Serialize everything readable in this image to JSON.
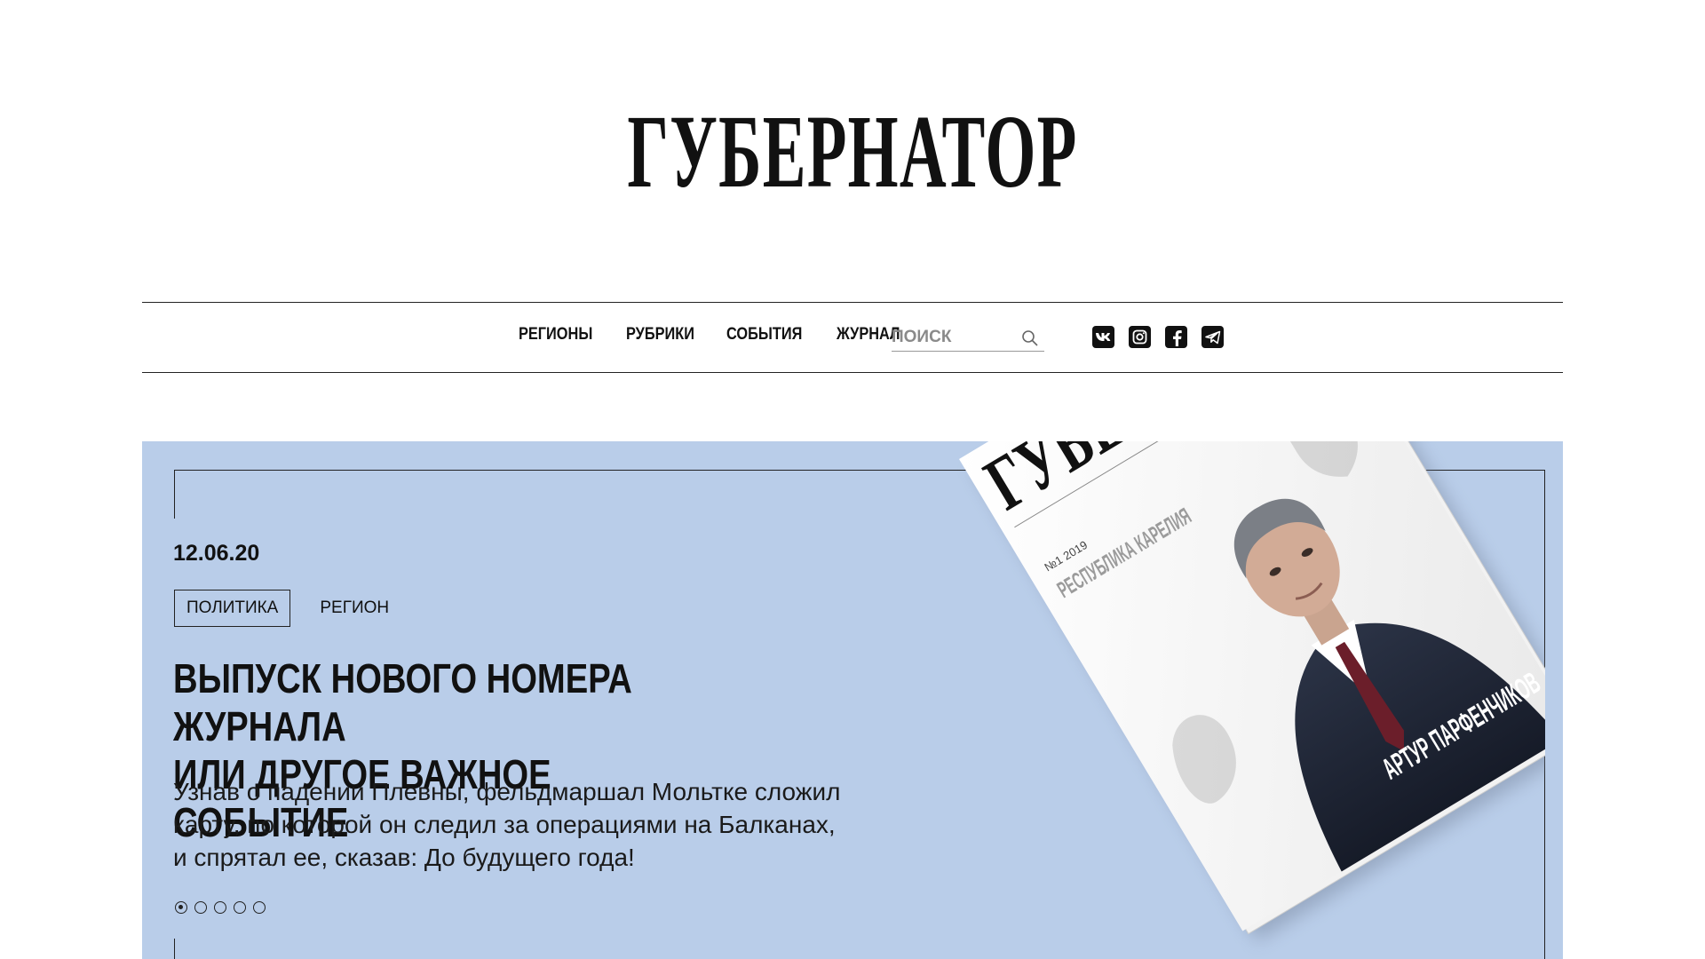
{
  "header": {
    "logo": "ГУБЕРНАТОР"
  },
  "nav": {
    "items": [
      "РЕГИОНЫ",
      "РУБРИКИ",
      "СОБЫТИЯ",
      "ЖУРНАЛ"
    ]
  },
  "search": {
    "placeholder": "ПОИСК",
    "icon": "search-icon"
  },
  "social": {
    "icons": [
      "vk-icon",
      "instagram-icon",
      "facebook-icon",
      "telegram-icon"
    ]
  },
  "hero": {
    "date": "12.06.20",
    "tags": [
      "ПОЛИТИКА",
      "РЕГИОН"
    ],
    "headline": "ВЫПУСК НОВОГО НОМЕРА ЖУРНАЛА\nИЛИ ДРУГОЕ ВАЖНОЕ СОБЫТИЕ",
    "description": "Узнав о падении Плевны, фельдмаршал Мольтке сложил карту, по которой он следил за операциями на Балканах, и спрятал ее, сказав: До будущего года!",
    "slides_total": 5,
    "active_slide": 1,
    "background_color": "#b9cde9",
    "cover": {
      "title": "ГУБЕРНАТОР",
      "issue": "№1 2019",
      "region_label": "РЕСПУБЛИКА КАРЕЛИЯ",
      "person": "АРТУР ПАРФЕНЧИКОВ"
    }
  }
}
